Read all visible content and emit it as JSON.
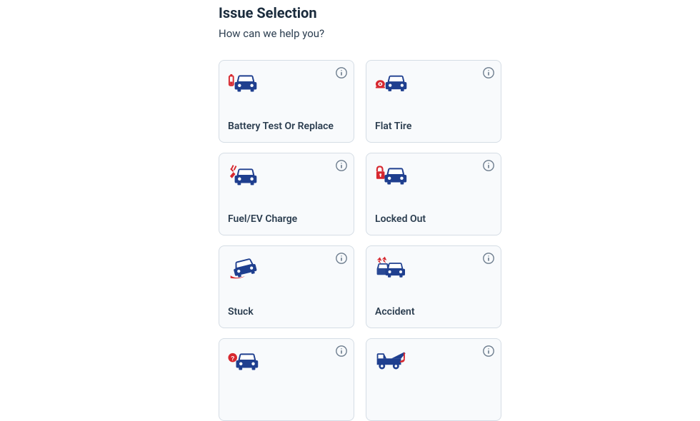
{
  "page": {
    "title": "Issue Selection",
    "subtitle": "How can we help you?"
  },
  "colors": {
    "primary_blue": "#1f3f8f",
    "accent_red": "#d7282f",
    "card_bg": "#f8fafc",
    "card_border": "#d5dde5",
    "info_color": "#6b7b8c"
  },
  "issues": [
    {
      "id": "battery",
      "label": "Battery Test Or Replace",
      "icon": "battery-car-icon"
    },
    {
      "id": "flat-tire",
      "label": "Flat Tire",
      "icon": "flat-tire-car-icon"
    },
    {
      "id": "fuel",
      "label": "Fuel/EV Charge",
      "icon": "fuel-car-icon"
    },
    {
      "id": "locked",
      "label": "Locked Out",
      "icon": "lock-car-icon"
    },
    {
      "id": "stuck",
      "label": "Stuck",
      "icon": "stuck-car-icon"
    },
    {
      "id": "accident",
      "label": "Accident",
      "icon": "accident-car-icon"
    },
    {
      "id": "unknown",
      "label": "",
      "icon": "question-car-icon"
    },
    {
      "id": "tow",
      "label": "",
      "icon": "tow-truck-icon"
    }
  ]
}
